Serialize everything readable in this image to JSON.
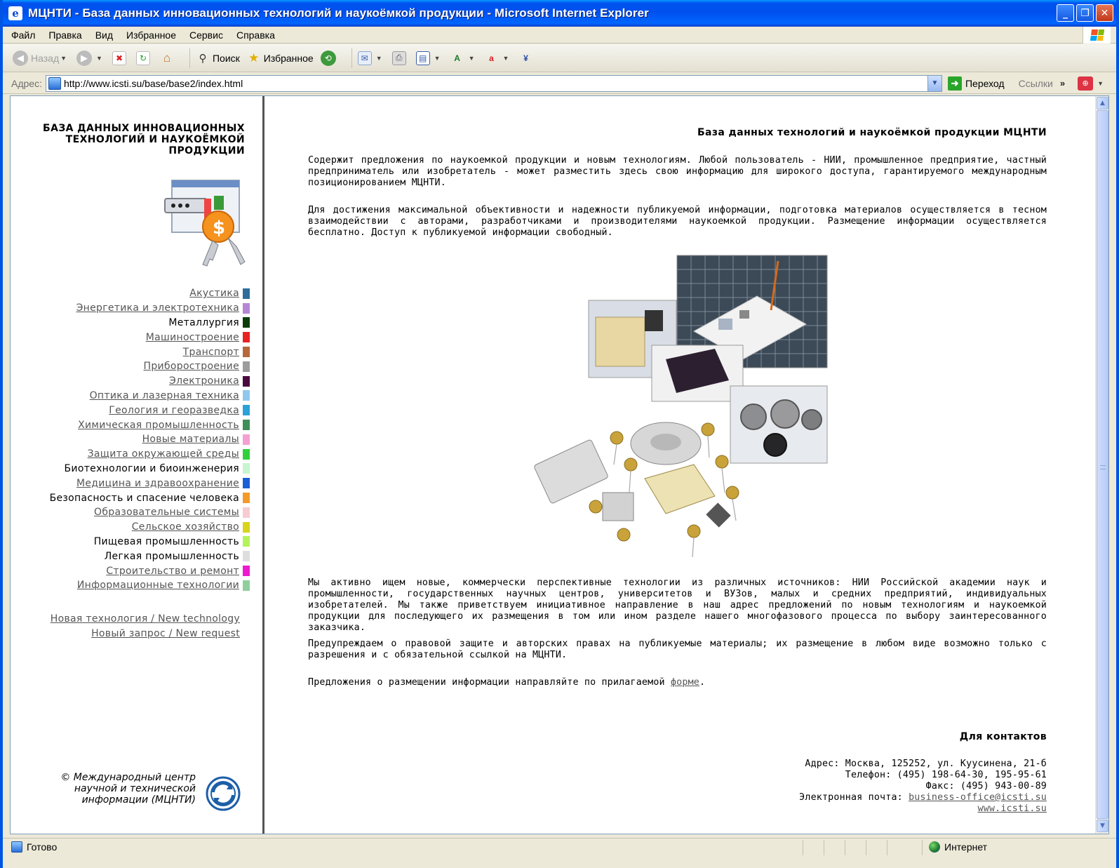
{
  "window": {
    "title": "МЦНТИ - База данных инновационных технологий и наукоёмкой продукции - Microsoft Internet Explorer",
    "icon": "ie-icon",
    "controls": [
      "minimize",
      "restore",
      "close"
    ]
  },
  "menu": {
    "items": [
      "Файл",
      "Правка",
      "Вид",
      "Избранное",
      "Сервис",
      "Справка"
    ]
  },
  "toolbar": {
    "back_label": "Назад",
    "search_label": "Поиск",
    "favorites_label": "Избранное"
  },
  "address": {
    "label": "Адрес:",
    "url": "http://www.icsti.su/base/base2/index.html",
    "go_label": "Переход",
    "links_label": "Ссылки"
  },
  "sidebar": {
    "title": "БАЗА ДАННЫХ ИННОВАЦИОННЫХ ТЕХНОЛОГИЙ И НАУКОЁМКОЙ ПРОДУКЦИИ",
    "categories": [
      {
        "label": "Акустика",
        "link": true,
        "color": "#2e6d9a"
      },
      {
        "label": "Энергетика и электротехника",
        "link": true,
        "color": "#b586d6"
      },
      {
        "label": "Металлургия",
        "link": false,
        "color": "#0b3d0b"
      },
      {
        "label": "Машиностроение",
        "link": true,
        "color": "#e82222"
      },
      {
        "label": "Транспорт",
        "link": true,
        "color": "#b5683a"
      },
      {
        "label": "Приборостроение",
        "link": true,
        "color": "#9c9c9c"
      },
      {
        "label": "Электроника",
        "link": true,
        "color": "#4a0a3f"
      },
      {
        "label": "Оптика и лазерная техника",
        "link": true,
        "color": "#8fc8ef"
      },
      {
        "label": "Геология и георазведка",
        "link": true,
        "color": "#2aa1d8"
      },
      {
        "label": "Химическая промышленность",
        "link": true,
        "color": "#3f8f5a"
      },
      {
        "label": "Новые материалы",
        "link": true,
        "color": "#f4a0d2"
      },
      {
        "label": "Защита окружающей среды",
        "link": true,
        "color": "#2fd13a"
      },
      {
        "label": "Биотехнологии и биоинженерия",
        "link": false,
        "color": "#c7f5cf"
      },
      {
        "label": "Медицина и здравоохранение",
        "link": true,
        "color": "#1b5fd6"
      },
      {
        "label": "Безопасность и спасение человека",
        "link": false,
        "color": "#f59a2a"
      },
      {
        "label": "Образовательные системы",
        "link": true,
        "color": "#f7cbd2"
      },
      {
        "label": "Сельское хозяйство",
        "link": true,
        "color": "#d8d31b"
      },
      {
        "label": "Пищевая промышленность",
        "link": false,
        "color": "#b4f35b"
      },
      {
        "label": "Легкая промышленность",
        "link": false,
        "color": "#dedede"
      },
      {
        "label": "Строительство и ремонт",
        "link": true,
        "color": "#ef1ad0"
      },
      {
        "label": "Информационные технологии",
        "link": true,
        "color": "#8fce9d"
      }
    ],
    "new_technology": "Новая технология / New technology",
    "new_request": "Новый запрос / New request",
    "copyright": "© Международный центр научной и технической информации (МЦНТИ)"
  },
  "main": {
    "heading": "База данных технологий и наукоёмкой продукции МЦНТИ",
    "p1": "Содержит предложения по наукоемкой продукции и новым технологиям. Любой пользователь - НИИ, промышленное предприятие, частный предприниматель или изобретатель - может разместить здесь свою информацию для широкого доступа, гарантируемого международным позиционированием МЦНТИ.",
    "p2": "Для достижения максимальной объективности и надежности публикуемой информации, подготовка материалов осуществляется в тесном взаимодействии с авторами, разработчиками и производителями наукоемкой продукции. Размещение информации осуществляется бесплатно. Доступ к публикуемой информации свободный.",
    "p3": "Мы активно ищем новые, коммерчески перспективные технологии из различных источников: НИИ Российской академии наук и промышленности, государственных научных центров, университетов и ВУЗов, малых и средних предприятий, индивидуальных изобретателей. Мы также приветствуем инициативное направление в наш адрес предложений по новым технологиям и наукоемкой продукции для последующего их размещения в том или ином разделе нашего многофазового процесса по выбору заинтересованного заказчика.",
    "p4": "Предупреждаем о правовой защите и авторских правах на публикуемые материалы; их размещение в любом виде возможно только с разрешения и с обязательной ссылкой на МЦНТИ.",
    "p5_prefix": "Предложения о размещении информации направляйте по прилагаемой ",
    "p5_link": "форме",
    "p5_suffix": ".",
    "contacts_heading": "Для контактов",
    "address": "Адрес: Москва, 125252, ул. Куусинена, 21-б",
    "phone": "Телефон: (495) 198-64-30, 195-95-61",
    "fax": "Факс: (495) 943-00-89",
    "email_label": "Электронная почта: ",
    "email": "business-office@icsti.su",
    "website": "www.icsti.su"
  },
  "status": {
    "text": "Готово",
    "zone": "Интернет"
  }
}
